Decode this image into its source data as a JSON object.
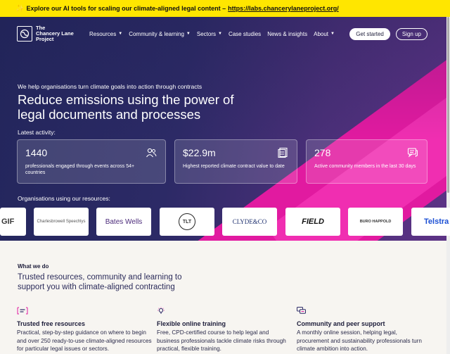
{
  "banner": {
    "icon": "sparkle-icon",
    "text": "Explore our AI tools for scaling our climate-aligned legal content –",
    "link": "https://labs.chancerylaneproject.org/"
  },
  "nav": {
    "logo_lines": [
      "The",
      "Chancery Lane",
      "Project"
    ],
    "items": [
      {
        "label": "Resources",
        "dropdown": true
      },
      {
        "label": "Community & learning",
        "dropdown": true
      },
      {
        "label": "Sectors",
        "dropdown": true
      },
      {
        "label": "Case studies",
        "dropdown": false
      },
      {
        "label": "News & insights",
        "dropdown": false
      },
      {
        "label": "About",
        "dropdown": true
      }
    ],
    "get_started": "Get started",
    "sign_up": "Sign up"
  },
  "hero": {
    "eyebrow": "We help organisations turn climate goals into action through contracts",
    "headline": "Reduce emissions using the power of legal documents and processes",
    "latest_label": "Latest activity:",
    "stats": [
      {
        "value": "1440",
        "desc": "professionals engaged through events across 54+ countries",
        "icon": "people-icon"
      },
      {
        "value": "$22.9m",
        "desc": "Highest reported climate contract value to date",
        "icon": "documents-icon"
      },
      {
        "value": "278",
        "desc": "Active community members in the last 30 days",
        "icon": "chat-icon"
      }
    ],
    "orgs_label": "Organisations using our resources:",
    "orgs": [
      "GIF",
      "Charlesbrowell Speechlys",
      "Bates Wells",
      "TLT",
      "CLYDE&CO",
      "FIELD",
      "BURO HAPPOLD",
      "Telstra"
    ]
  },
  "what": {
    "label": "What we do",
    "subtitle": "Trusted resources, community and learning to support you with climate-aligned contracting",
    "features": [
      {
        "title": "Trusted free resources",
        "text": "Practical, step-by-step guidance on where to begin and over 250 ready-to-use climate-aligned resources for particular legal issues or sectors.",
        "icon": "document-lines-icon"
      },
      {
        "title": "Flexible online training",
        "text": "Free, CPD-certified course to help legal and business professionals tackle climate risks through practical, flexible training.",
        "icon": "lightbulb-icon"
      },
      {
        "title": "Community and peer support",
        "text": "A monthly online session, helping legal, procurement and sustainability professionals turn climate ambition into action.",
        "icon": "speech-bubbles-icon"
      }
    ]
  },
  "colors": {
    "accent": "#e11aa0",
    "banner": "#ffe600",
    "navy": "#23265c"
  }
}
